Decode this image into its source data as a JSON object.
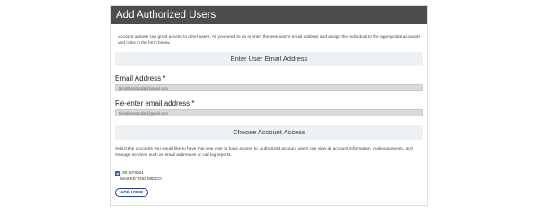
{
  "header": {
    "title": "Add Authorized Users"
  },
  "intro_text": "Account owners can grant access to other users. All you need to do is enter the new user's email address and assign the individual to the appropriate accounts and roles in the form below.",
  "email_section": {
    "title": "Enter User Email Address",
    "email_label": "Email Address",
    "email_value": "timdobsonsodak@gmail.com",
    "confirm_label": "Re-enter email address",
    "confirm_value": "timdobsonsodak@gmail.com",
    "required_mark": "*"
  },
  "access_section": {
    "title": "Choose Account Access",
    "help_text": "Select the accounts you would like to have this new user to have access to. Authorized account users can view all account information, make payments, and manage services such as email addresses or call log reports.",
    "accounts": [
      {
        "number": "301979501",
        "name": "MARKETING MIDCO",
        "checked": true
      }
    ]
  },
  "add_button_label": "ADD USER",
  "colors": {
    "header_bg": "#4d4d4d",
    "section_bg": "#eef1f4",
    "button_accent": "#1f3f8f"
  }
}
